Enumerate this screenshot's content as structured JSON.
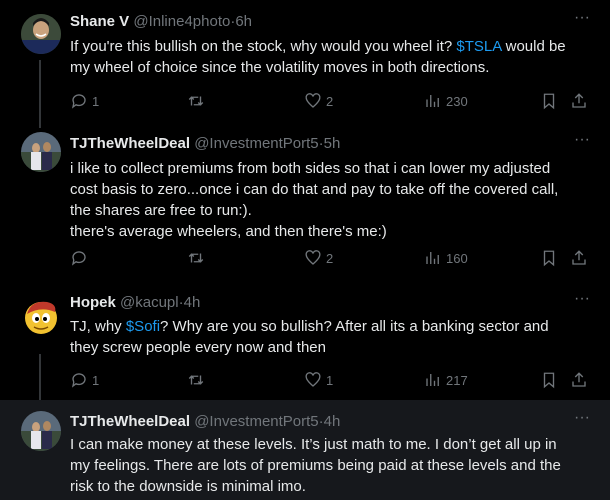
{
  "tweets": [
    {
      "name": "Shane V",
      "handle": "@Inline4photo",
      "sep": "·",
      "time": "6h",
      "text_lines": [
        [
          "If you're this bullish on the stock, why would you wheel it? ",
          "$TSLA",
          " would be"
        ],
        [
          "my wheel of choice since the volatility moves in both directions."
        ]
      ],
      "replies": "1",
      "retweets": "",
      "likes": "2",
      "views": "230"
    },
    {
      "name": "TJTheWheelDeal",
      "handle": "@InvestmentPort5",
      "sep": "·",
      "time": "5h",
      "lines": [
        "i like to collect premiums from both sides so that i can lower my adjusted",
        "cost basis to zero...once i can do that and pay to take off the covered call,",
        "the shares are free to run:).",
        "there's average wheelers, and then there's me:)"
      ],
      "replies": "",
      "retweets": "",
      "likes": "2",
      "views": "160"
    },
    {
      "name": "Hopek",
      "handle": "@kacupl",
      "sep": "·",
      "time": "4h",
      "text_lines": [
        [
          "TJ, why ",
          "$Sofi",
          "? Why are you so bullish? After all its a banking sector and"
        ],
        [
          "they screw people every now and then"
        ]
      ],
      "replies": "1",
      "retweets": "",
      "likes": "1",
      "views": "217"
    },
    {
      "name": "TJTheWheelDeal",
      "handle": "@InvestmentPort5",
      "sep": "·",
      "time": "4h",
      "lines": [
        "I can make money at these levels. It’s just math to me. I don’t get all up in",
        "my feelings. There are lots of premiums being paid at these levels and the",
        "risk to the downside is minimal imo."
      ]
    }
  ],
  "more_glyph": "···",
  "colors": {
    "accent": "#1d9bf0",
    "muted": "#71767b",
    "text": "#e7e9ea",
    "bg": "#000000"
  }
}
